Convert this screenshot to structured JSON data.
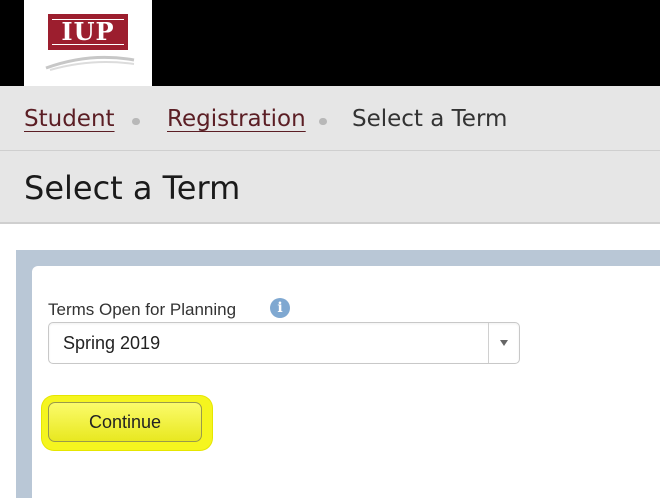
{
  "header": {
    "logo_text": "IUP",
    "brand_color": "#9c1e2e"
  },
  "breadcrumb": {
    "items": [
      {
        "label": "Student"
      },
      {
        "label": "Registration"
      },
      {
        "label": "Select a Term"
      }
    ]
  },
  "page": {
    "title": "Select a Term"
  },
  "form": {
    "term_label": "Terms Open for Planning",
    "term_selected": "Spring 2019",
    "continue_label": "Continue",
    "highlight_color": "#f5f51f"
  }
}
